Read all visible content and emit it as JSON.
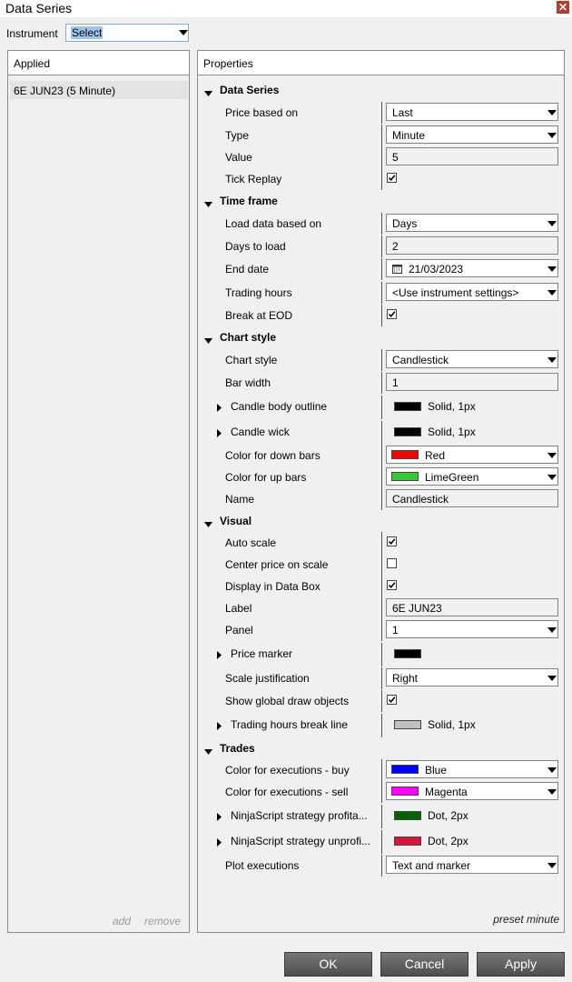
{
  "window": {
    "title": "Data Series"
  },
  "instrument": {
    "label": "Instrument",
    "value": "Select"
  },
  "applied": {
    "header": "Applied",
    "items": [
      "6E JUN23 (5 Minute)"
    ],
    "add_label": "add",
    "remove_label": "remove"
  },
  "properties": {
    "header": "Properties",
    "sections": {
      "data_series": {
        "title": "Data Series",
        "price_based_on": {
          "label": "Price based on",
          "value": "Last"
        },
        "type": {
          "label": "Type",
          "value": "Minute"
        },
        "value": {
          "label": "Value",
          "value": "5"
        },
        "tick_replay": {
          "label": "Tick Replay",
          "checked": true
        }
      },
      "time_frame": {
        "title": "Time frame",
        "load_data": {
          "label": "Load data based on",
          "value": "Days"
        },
        "days_to_load": {
          "label": "Days to load",
          "value": "2"
        },
        "end_date": {
          "label": "End date",
          "value": "21/03/2023"
        },
        "trading_hours": {
          "label": "Trading hours",
          "value": "<Use instrument settings>"
        },
        "break_eod": {
          "label": "Break at EOD",
          "checked": true
        }
      },
      "chart_style": {
        "title": "Chart style",
        "chart_style": {
          "label": "Chart style",
          "value": "Candlestick"
        },
        "bar_width": {
          "label": "Bar width",
          "value": "1"
        },
        "candle_body_outline": {
          "label": "Candle body outline",
          "value": "Solid, 1px",
          "color": "#000000"
        },
        "candle_wick": {
          "label": "Candle wick",
          "value": "Solid, 1px",
          "color": "#000000"
        },
        "down_bars": {
          "label": "Color for down bars",
          "value": "Red",
          "color": "#ff0000"
        },
        "up_bars": {
          "label": "Color for up bars",
          "value": "LimeGreen",
          "color": "#32cd32"
        },
        "name": {
          "label": "Name",
          "value": "Candlestick"
        }
      },
      "visual": {
        "title": "Visual",
        "auto_scale": {
          "label": "Auto scale",
          "checked": true
        },
        "center_price": {
          "label": "Center price on scale",
          "checked": false
        },
        "display_data_box": {
          "label": "Display in Data Box",
          "checked": true
        },
        "label": {
          "label": "Label",
          "value": "6E JUN23"
        },
        "panel": {
          "label": "Panel",
          "value": "1"
        },
        "price_marker": {
          "label": "Price marker",
          "color": "#000000"
        },
        "scale_justification": {
          "label": "Scale justification",
          "value": "Right"
        },
        "global_draw": {
          "label": "Show global draw objects",
          "checked": true
        },
        "hours_break": {
          "label": "Trading hours break line",
          "value": "Solid, 1px",
          "color": "#c0c0c0"
        }
      },
      "trades": {
        "title": "Trades",
        "exec_buy": {
          "label": "Color for executions - buy",
          "value": "Blue",
          "color": "#0000ff"
        },
        "exec_sell": {
          "label": "Color for executions - sell",
          "value": "Magenta",
          "color": "#ff00ff"
        },
        "profitable": {
          "label": "NinjaScript strategy profita...",
          "value": "Dot, 2px",
          "color": "#006400"
        },
        "unprofitable": {
          "label": "NinjaScript strategy unprofi...",
          "value": "Dot, 2px",
          "color": "#dc143c"
        },
        "plot_exec": {
          "label": "Plot executions",
          "value": "Text and marker"
        }
      }
    },
    "preset_label": "preset minute"
  },
  "buttons": {
    "ok": "OK",
    "cancel": "Cancel",
    "apply": "Apply"
  }
}
